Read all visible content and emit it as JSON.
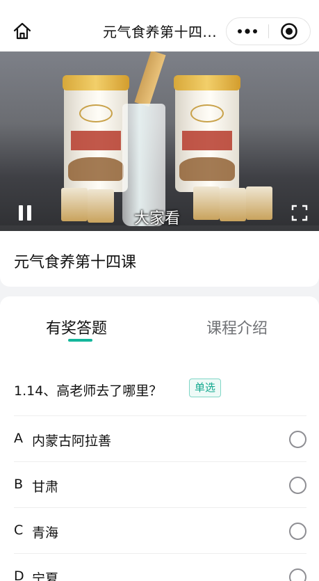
{
  "nav": {
    "title": "元气食养第十四...",
    "home_icon": "home-icon",
    "more_icon": "more-dots-icon",
    "close_icon": "target-close-icon"
  },
  "video": {
    "subtitle": "大家看",
    "pause_icon": "pause-icon",
    "fullscreen_icon": "fullscreen-icon"
  },
  "course": {
    "title": "元气食养第十四课"
  },
  "tabs": [
    {
      "label": "有奖答题",
      "active": true
    },
    {
      "label": "课程介绍",
      "active": false
    }
  ],
  "quiz": {
    "question": "1.14、高老师去了哪里？",
    "type_badge": "单选",
    "options": [
      {
        "letter": "A",
        "text": "内蒙古阿拉善"
      },
      {
        "letter": "B",
        "text": "甘肃"
      },
      {
        "letter": "C",
        "text": "青海"
      },
      {
        "letter": "D",
        "text": "宁夏"
      }
    ]
  },
  "colors": {
    "accent": "#13b69b",
    "badge_border": "#7fd6c6",
    "badge_bg": "#eefaf7",
    "page_bg": "#f2f3f5"
  }
}
